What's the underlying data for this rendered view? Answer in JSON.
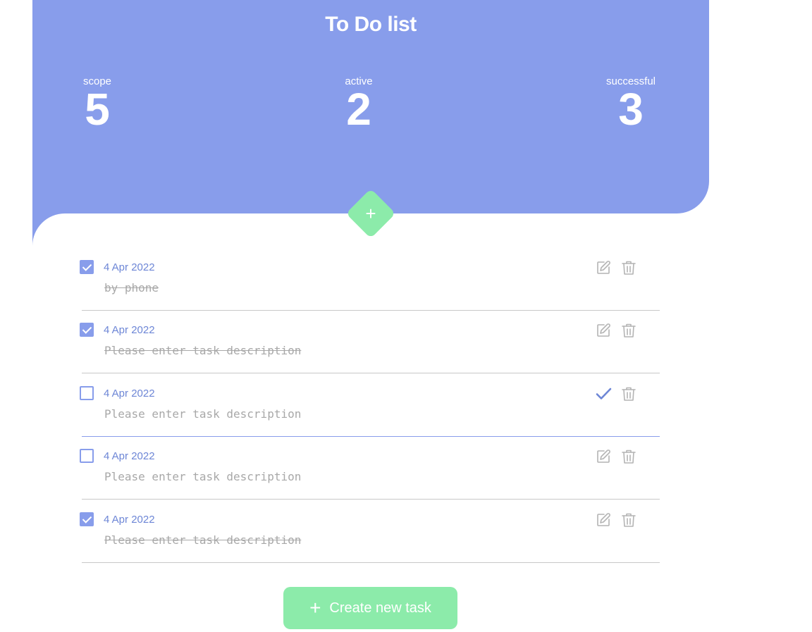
{
  "header": {
    "title": "To Do list",
    "stats": {
      "scope": {
        "label": "scope",
        "value": "5"
      },
      "active": {
        "label": "active",
        "value": "2"
      },
      "successful": {
        "label": "successful",
        "value": "3"
      }
    }
  },
  "add_button": {
    "icon": "plus-icon",
    "glyph": "+"
  },
  "tasks": [
    {
      "date": "4 Apr 2022",
      "description": "by phone",
      "checked": true,
      "editing": false
    },
    {
      "date": "4 Apr 2022",
      "description": "Please enter task description",
      "checked": true,
      "editing": false
    },
    {
      "date": "4 Apr 2022",
      "description": "Please enter task description",
      "checked": false,
      "editing": true
    },
    {
      "date": "4 Apr 2022",
      "description": "Please enter task description",
      "checked": false,
      "editing": false
    },
    {
      "date": "4 Apr 2022",
      "description": "Please enter task description",
      "checked": true,
      "editing": false
    }
  ],
  "create_button": {
    "label": "Create new task",
    "glyph": "+"
  },
  "colors": {
    "header": "#889deb",
    "accent_green": "#8cebaa",
    "date_text": "#6d86d6",
    "muted_text": "#a8a8a8"
  }
}
